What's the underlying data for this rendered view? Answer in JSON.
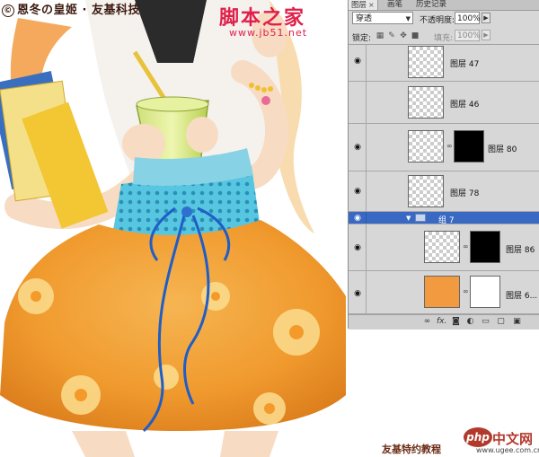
{
  "artwork": {
    "watermark_top": "恩冬の皇姬 · 友基科技",
    "copyright_symbol": "©",
    "site_title_cn": "脚本之家",
    "site_url": "www.jb51.net",
    "bottom_credit": "友基特约教程",
    "php_logo": "php",
    "php_site_cn": "中文网",
    "php_site_url": "www.ugee.com.cn"
  },
  "panel": {
    "tabs": [
      {
        "label": "图层",
        "active": true,
        "close": "×"
      },
      {
        "label": "画笔",
        "active": false
      },
      {
        "label": "历史记录",
        "active": false
      }
    ],
    "blend_mode": "穿透",
    "opacity_label": "不透明度:",
    "opacity_value": "100%",
    "lock_label": "锁定:",
    "fill_label": "填充:",
    "fill_value": "100%",
    "layers": [
      {
        "name": "图层 47",
        "type": "layer",
        "visible": true,
        "has_mask": false
      },
      {
        "name": "图层 46",
        "type": "layer",
        "visible": false,
        "has_mask": false
      },
      {
        "name": "图层 80",
        "type": "layer",
        "visible": true,
        "has_mask": true
      },
      {
        "name": "图层 78",
        "type": "layer",
        "visible": true,
        "has_mask": false
      },
      {
        "name": "组 7",
        "type": "group",
        "visible": true,
        "expanded": true
      },
      {
        "name": "图层 86",
        "type": "layer",
        "visible": true,
        "has_mask": true
      },
      {
        "name": "图层 6...",
        "type": "layer",
        "visible": true,
        "has_mask": true
      }
    ],
    "bottom_icons": [
      "link-icon",
      "fx-icon",
      "mask-icon",
      "adjustment-icon",
      "group-icon",
      "new-layer-icon",
      "trash-icon"
    ],
    "bottom_fx_text": "fx."
  },
  "colors": {
    "panel_bg": "#d7d7d7",
    "selected_row": "#3a69c4",
    "site_red": "#e0204a"
  }
}
